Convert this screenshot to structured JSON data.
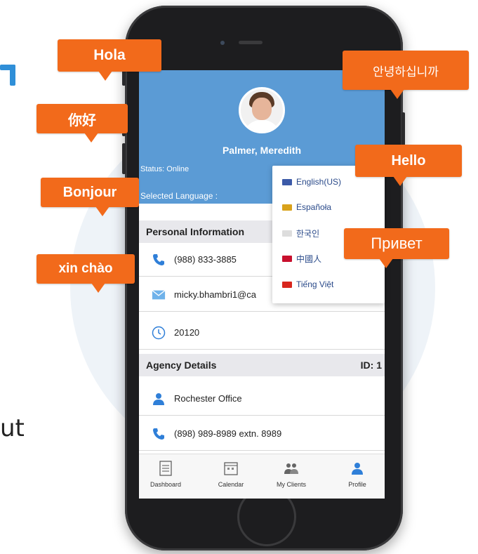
{
  "greetings": {
    "hola": "Hola",
    "nihao": "你好",
    "bonjour": "Bonjour",
    "xinchao": "xin chào",
    "annyeong": "안녕하십니까",
    "hello": "Hello",
    "privet": "Привет"
  },
  "background_text": "ut",
  "profile": {
    "name": "Palmer, Meredith",
    "status": "Status: Online",
    "selected_language_label": "Selected Language :"
  },
  "language_dropdown": [
    {
      "label": "English(US)",
      "flag_color": "#3c5aa8"
    },
    {
      "label": "Españoła",
      "flag_color": "#d9a21b"
    },
    {
      "label": "한국인",
      "flag_color": "#dddddd"
    },
    {
      "label": "中國人",
      "flag_color": "#c8102e"
    },
    {
      "label": "Tiếng Việt",
      "flag_color": "#d8261d"
    }
  ],
  "personal_information": {
    "title": "Personal Information",
    "phone": "(988) 833-3885",
    "email": "micky.bhambri1@ca",
    "zip": "20120"
  },
  "agency_details": {
    "title": "Agency Details",
    "id_label": "ID: 1",
    "office": "Rochester Office",
    "phone": "(898) 989-8989 extn. 8989"
  },
  "tabbar": {
    "dashboard": "Dashboard",
    "calendar": "Calendar",
    "my_clients": "My Clients",
    "profile": "Profile"
  },
  "colors": {
    "header_blue": "#5b9bd5",
    "bubble_orange": "#f26a1b",
    "icon_blue": "#2f7fd8"
  }
}
